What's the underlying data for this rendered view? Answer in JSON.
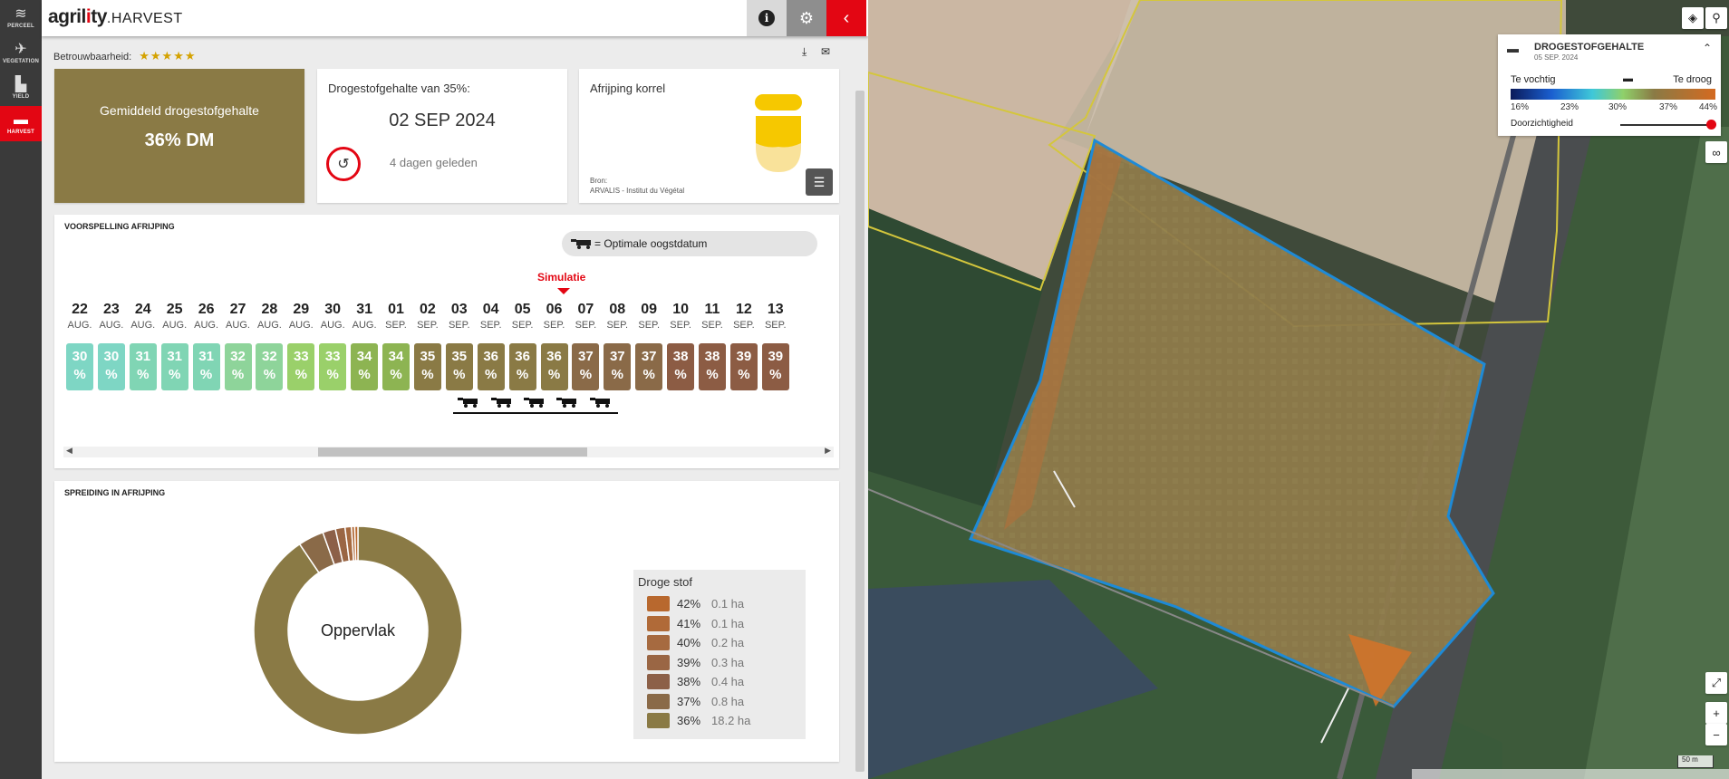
{
  "rail": [
    {
      "label": "PERCEEL",
      "icon": "field-icon",
      "glyph": "≋",
      "active": false
    },
    {
      "label": "VEGETATION",
      "icon": "satellite-icon",
      "glyph": "✈",
      "active": false
    },
    {
      "label": "YIELD",
      "icon": "yield-icon",
      "glyph": "▙",
      "active": false
    },
    {
      "label": "HARVEST",
      "icon": "harvester-icon",
      "glyph": "▬",
      "active": true
    }
  ],
  "header": {
    "logo_a": "agril",
    "logo_i": "i",
    "logo_b": "ty",
    "logo_c": ".HARVEST",
    "info": "i",
    "gear": "⚙",
    "close": "‹"
  },
  "reliability": {
    "label": "Betrouwbaarheid:",
    "stars": "★★★★★"
  },
  "tools": {
    "download": "⤓",
    "mail": "✉"
  },
  "avg": {
    "title": "Gemiddeld drogestofgehalte",
    "value": "36% DM"
  },
  "target": {
    "title": "Drogestofgehalte van 35%:",
    "date": "02 SEP 2024",
    "ago": "4 dagen geleden",
    "reset": "↺"
  },
  "ripening": {
    "title": "Afrijping korrel",
    "source_label": "Bron:",
    "source": "ARVALIS - Institut du Végétal",
    "list": "☰"
  },
  "forecast": {
    "title": "VOORSPELLING AFRIJPING",
    "legend": "= Optimale oogstdatum",
    "simulation": "Simulatie",
    "days": [
      {
        "d": "22",
        "m": "AUG.",
        "v": "30"
      },
      {
        "d": "23",
        "m": "AUG.",
        "v": "30"
      },
      {
        "d": "24",
        "m": "AUG.",
        "v": "31"
      },
      {
        "d": "25",
        "m": "AUG.",
        "v": "31"
      },
      {
        "d": "26",
        "m": "AUG.",
        "v": "31"
      },
      {
        "d": "27",
        "m": "AUG.",
        "v": "32"
      },
      {
        "d": "28",
        "m": "AUG.",
        "v": "32"
      },
      {
        "d": "29",
        "m": "AUG.",
        "v": "33"
      },
      {
        "d": "30",
        "m": "AUG.",
        "v": "33"
      },
      {
        "d": "31",
        "m": "AUG.",
        "v": "34"
      },
      {
        "d": "01",
        "m": "SEP.",
        "v": "34"
      },
      {
        "d": "02",
        "m": "SEP.",
        "v": "35"
      },
      {
        "d": "03",
        "m": "SEP.",
        "v": "35"
      },
      {
        "d": "04",
        "m": "SEP.",
        "v": "36"
      },
      {
        "d": "05",
        "m": "SEP.",
        "v": "36"
      },
      {
        "d": "06",
        "m": "SEP.",
        "v": "36"
      },
      {
        "d": "07",
        "m": "SEP.",
        "v": "37"
      },
      {
        "d": "08",
        "m": "SEP.",
        "v": "37"
      },
      {
        "d": "09",
        "m": "SEP.",
        "v": "37"
      },
      {
        "d": "10",
        "m": "SEP.",
        "v": "38"
      },
      {
        "d": "11",
        "m": "SEP.",
        "v": "38"
      },
      {
        "d": "12",
        "m": "SEP.",
        "v": "39"
      },
      {
        "d": "13",
        "m": "SEP.",
        "v": "39"
      }
    ],
    "pct_sign": "%",
    "scroll_left": "◀",
    "scroll_right": "▶"
  },
  "spread": {
    "title": "SPREIDING IN AFRIJPING",
    "center": "Oppervlak",
    "legend_title": "Droge stof",
    "rows": [
      {
        "pct": "42%",
        "area": "0.1 ha",
        "color": "#b8682e"
      },
      {
        "pct": "41%",
        "area": "0.1 ha",
        "color": "#b06a38"
      },
      {
        "pct": "40%",
        "area": "0.2 ha",
        "color": "#a66a40"
      },
      {
        "pct": "39%",
        "area": "0.3 ha",
        "color": "#9a6644"
      },
      {
        "pct": "38%",
        "area": "0.4 ha",
        "color": "#8c6048"
      },
      {
        "pct": "37%",
        "area": "0.8 ha",
        "color": "#8a6a48"
      },
      {
        "pct": "36%",
        "area": "18.2 ha",
        "color": "#8a7a45"
      }
    ]
  },
  "map_legend": {
    "title": "DROGESTOFGEHALTE",
    "date": "05 SEP. 2024",
    "wet": "Te vochtig",
    "dry": "Te droog",
    "ticks": [
      "16%",
      "23%",
      "30%",
      "37%",
      "44%"
    ],
    "opacity": "Doorzichtigheid",
    "collapse": "⌃"
  },
  "map_controls": {
    "layers": "◈",
    "search": "⚲",
    "fullscreen": "⤢",
    "zoom_in": "+",
    "zoom_out": "−",
    "scale": "50 m"
  },
  "colors": {
    "accent": "#e30613",
    "dm_brown": "#8a7a45",
    "field_outline": "#1e8ad6"
  }
}
